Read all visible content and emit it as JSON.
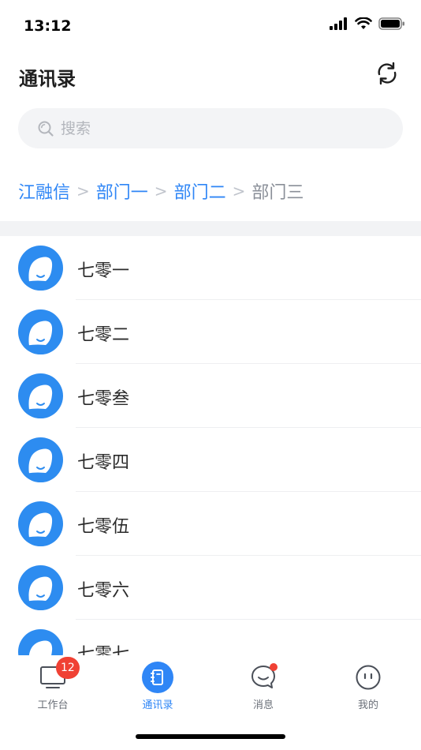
{
  "status_bar": {
    "time": "13:12"
  },
  "header": {
    "title": "通讯录",
    "refresh_icon": "refresh-icon"
  },
  "search": {
    "placeholder": "搜索",
    "value": ""
  },
  "breadcrumb": [
    {
      "label": "江融信",
      "current": false
    },
    {
      "label": "部门一",
      "current": false
    },
    {
      "label": "部门二",
      "current": false
    },
    {
      "label": "部门三",
      "current": true
    }
  ],
  "contacts": [
    {
      "name": "七零一"
    },
    {
      "name": "七零二"
    },
    {
      "name": "七零叁"
    },
    {
      "name": "七零四"
    },
    {
      "name": "七零伍"
    },
    {
      "name": "七零六"
    },
    {
      "name": "七零七"
    }
  ],
  "tabs": [
    {
      "label": "工作台",
      "icon": "workbench-icon",
      "badge": "12",
      "active": false
    },
    {
      "label": "通讯录",
      "icon": "contacts-icon",
      "active": true
    },
    {
      "label": "消息",
      "icon": "message-icon",
      "dot": true,
      "active": false
    },
    {
      "label": "我的",
      "icon": "profile-icon",
      "active": false
    }
  ],
  "colors": {
    "accent": "#2f86f6",
    "avatar": "#2d8cf0",
    "badge": "#f04134"
  }
}
